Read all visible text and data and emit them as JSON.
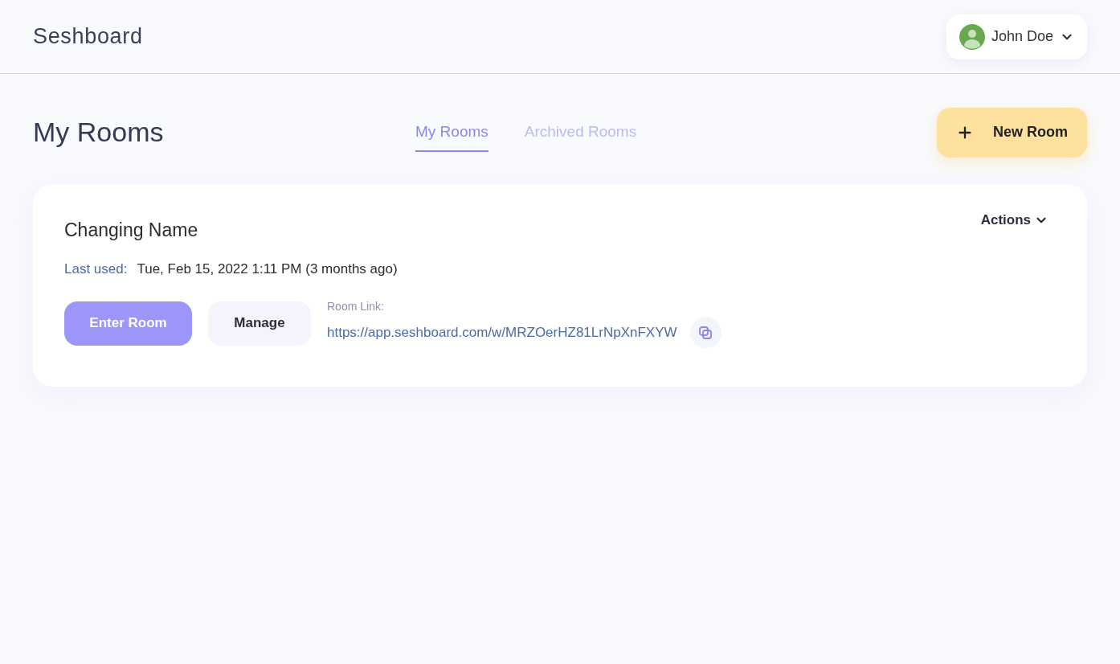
{
  "header": {
    "logo": "Seshboard",
    "user": {
      "name": "John Doe"
    }
  },
  "page": {
    "title": "My Rooms",
    "tabs": [
      {
        "label": "My Rooms",
        "selected": true
      },
      {
        "label": "Archived Rooms",
        "selected": false
      }
    ],
    "new_room_button": "New Room"
  },
  "rooms": [
    {
      "name": "Changing Name",
      "actions": "Actions",
      "last_used_label": "Last used:",
      "last_used": "Tue, Feb 15, 2022 1:11 PM (3 months ago)",
      "enter_button": "Enter Room",
      "manage_button": "Manage",
      "link_label": "Room Link:",
      "link": "https://app.seshboard.com/w/MRZOerHZ81LrNpXnFXYW"
    }
  ]
}
